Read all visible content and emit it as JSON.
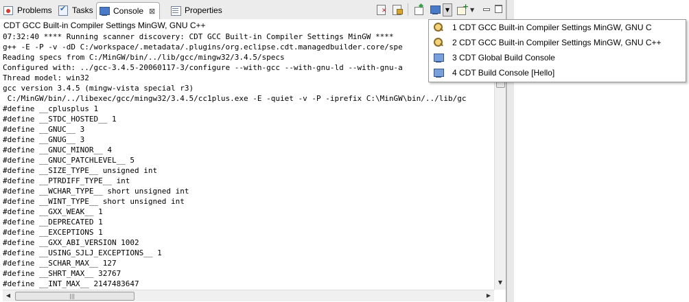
{
  "tabs": [
    {
      "label": "Problems",
      "icon": "problems-icon"
    },
    {
      "label": "Tasks",
      "icon": "tasks-icon"
    },
    {
      "label": "Console",
      "icon": "console-icon",
      "active": true
    },
    {
      "label": "Properties",
      "icon": "properties-icon"
    }
  ],
  "console": {
    "title": "CDT GCC Built-in Compiler Settings MinGW, GNU C++",
    "lines": [
      "07:32:40 **** Running scanner discovery: CDT GCC Built-in Compiler Settings MinGW ****",
      "g++ -E -P -v -dD C:/workspace/.metadata/.plugins/org.eclipse.cdt.managedbuilder.core/spe",
      "Reading specs from C:/MinGW/bin/../lib/gcc/mingw32/3.4.5/specs",
      "Configured with: ../gcc-3.4.5-20060117-3/configure --with-gcc --with-gnu-ld --with-gnu-a",
      "Thread model: win32",
      "gcc version 3.4.5 (mingw-vista special r3)",
      " C:/MinGW/bin/../libexec/gcc/mingw32/3.4.5/cc1plus.exe -E -quiet -v -P -iprefix C:\\MinGW\\bin/../lib/gc",
      "#define __cplusplus 1",
      "#define __STDC_HOSTED__ 1",
      "#define __GNUC__ 3",
      "#define __GNUG__ 3",
      "#define __GNUC_MINOR__ 4",
      "#define __GNUC_PATCHLEVEL__ 5",
      "#define __SIZE_TYPE__ unsigned int",
      "#define __PTRDIFF_TYPE__ int",
      "#define __WCHAR_TYPE__ short unsigned int",
      "#define __WINT_TYPE__ short unsigned int",
      "#define __GXX_WEAK__ 1",
      "#define __DEPRECATED 1",
      "#define __EXCEPTIONS 1",
      "#define __GXX_ABI_VERSION 1002",
      "#define __USING_SJLJ_EXCEPTIONS__ 1",
      "#define __SCHAR_MAX__ 127",
      "#define __SHRT_MAX__ 32767",
      "#define __INT_MAX__ 2147483647"
    ]
  },
  "menu": {
    "items": [
      {
        "label": "1 CDT GCC Built-in Compiler Settings MinGW, GNU C",
        "icon": "scanner-console-icon"
      },
      {
        "label": "2 CDT GCC Built-in Compiler Settings MinGW, GNU C++",
        "icon": "scanner-console-icon"
      },
      {
        "label": "3 CDT Global Build Console",
        "icon": "build-console-icon"
      },
      {
        "label": "4 CDT Build Console [Hello]",
        "icon": "build-console-icon"
      }
    ]
  },
  "toolbar": {
    "icons": [
      "clear-console-icon",
      "scroll-lock-icon",
      "pin-console-icon",
      "display-selected-console-icon",
      "open-console-icon",
      "minimize-icon",
      "maximize-icon"
    ]
  },
  "colors": {
    "tabbar_bg": "#ececec",
    "console_console_icon": "#4a7bc8"
  }
}
